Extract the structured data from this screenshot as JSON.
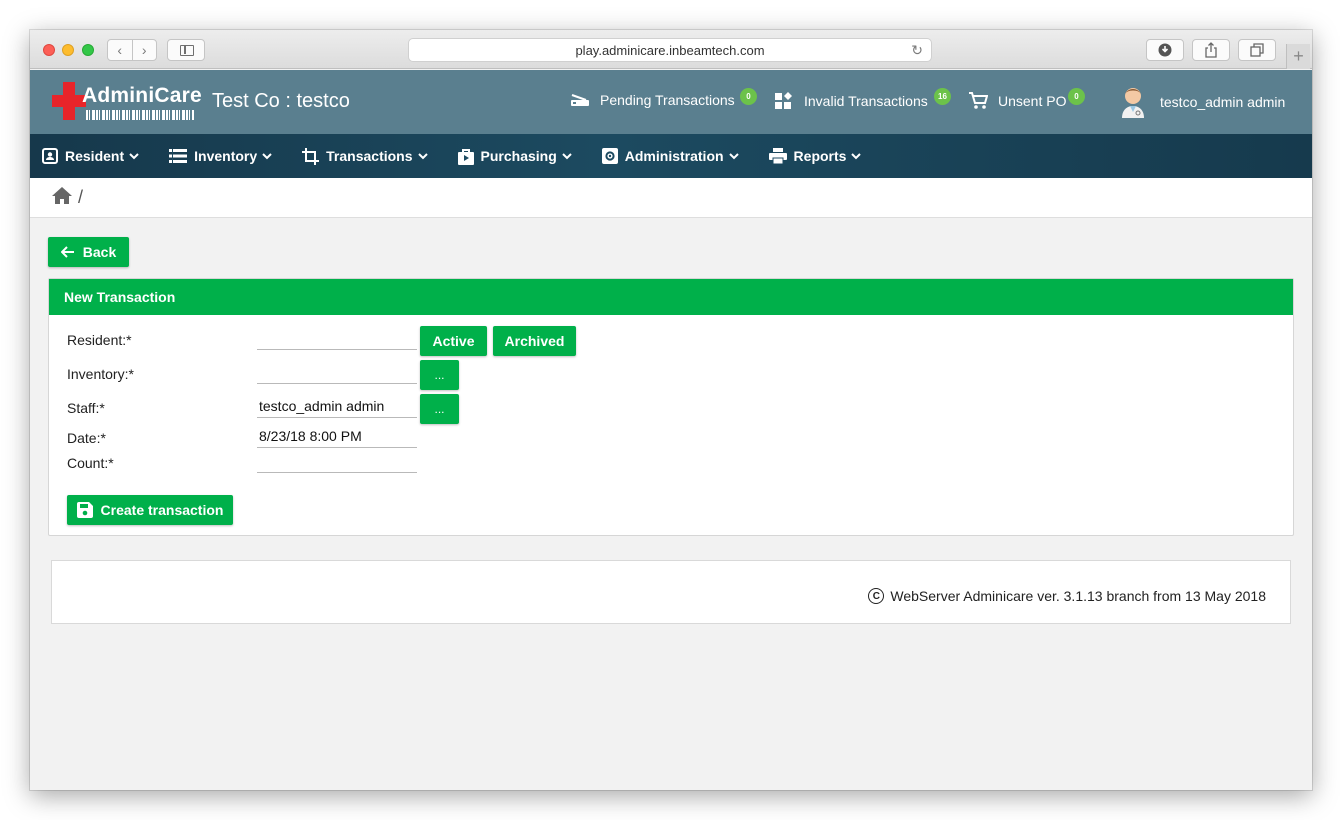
{
  "browser": {
    "url": "play.adminicare.inbeamtech.com"
  },
  "header": {
    "logo_text": "AdminiCare",
    "company": "Test Co : testco",
    "pending": {
      "label": "Pending Transactions",
      "count": "0"
    },
    "invalid": {
      "label": "Invalid Transactions",
      "count": "16"
    },
    "unsent": {
      "label": "Unsent PO",
      "count": "0"
    },
    "user": "testco_admin admin"
  },
  "nav": {
    "items": [
      {
        "label": "Resident",
        "icon": "contact-card-icon"
      },
      {
        "label": "Inventory",
        "icon": "list-icon"
      },
      {
        "label": "Transactions",
        "icon": "crop-icon"
      },
      {
        "label": "Purchasing",
        "icon": "shopping-bag-icon"
      },
      {
        "label": "Administration",
        "icon": "settings-box-icon"
      },
      {
        "label": "Reports",
        "icon": "printer-icon"
      }
    ]
  },
  "breadcrumb": {
    "separator": "/"
  },
  "page": {
    "back_label": "Back",
    "card_title": "New Transaction",
    "fields": {
      "resident": {
        "label": "Resident:*",
        "value": ""
      },
      "inventory": {
        "label": "Inventory:*",
        "value": ""
      },
      "staff": {
        "label": "Staff:*",
        "value": "testco_admin admin"
      },
      "date": {
        "label": "Date:*",
        "value": "8/23/18 8:00 PM"
      },
      "count": {
        "label": "Count:*",
        "value": ""
      }
    },
    "active_label": "Active",
    "archived_label": "Archived",
    "picker_label": "...",
    "create_label": "Create transaction"
  },
  "footer": {
    "copyright_symbol": "C",
    "text": "WebServer Adminicare ver. 3.1.13 branch from 13 May 2018"
  },
  "colors": {
    "accent_green": "#00b04a",
    "header_bg": "#5a7f8f",
    "nav_bg": "#1c4a60",
    "badge_green": "#6cc24a"
  }
}
